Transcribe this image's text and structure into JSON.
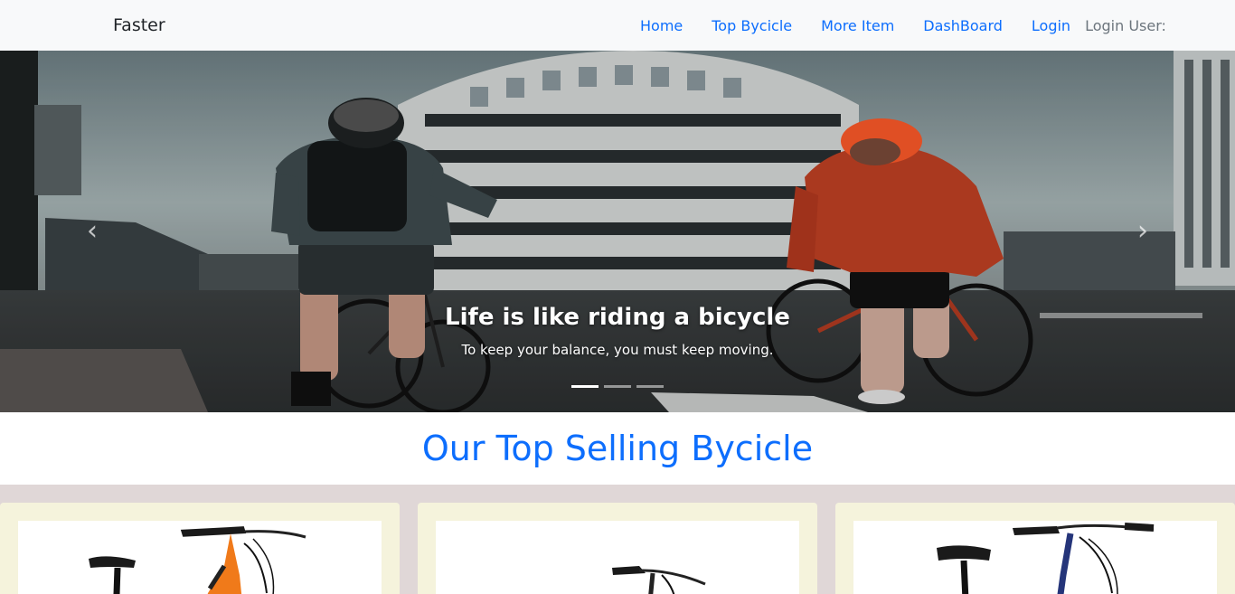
{
  "navbar": {
    "brand": "Faster",
    "links": [
      "Home",
      "Top Bycicle",
      "More Item",
      "DashBoard",
      "Login"
    ],
    "user_label": "Login User:"
  },
  "hero": {
    "title": "Life is like riding a bicycle",
    "subtitle": "To keep your balance, you must keep moving.",
    "slide_count": 3,
    "active_slide": 1
  },
  "products_section": {
    "title": "Our Top Selling Bycicle"
  },
  "colors": {
    "primary": "#0d6efd",
    "navbar_bg": "#f8f9fa",
    "products_bg": "#e0d7d7",
    "card_bg": "#f5f3dc"
  }
}
